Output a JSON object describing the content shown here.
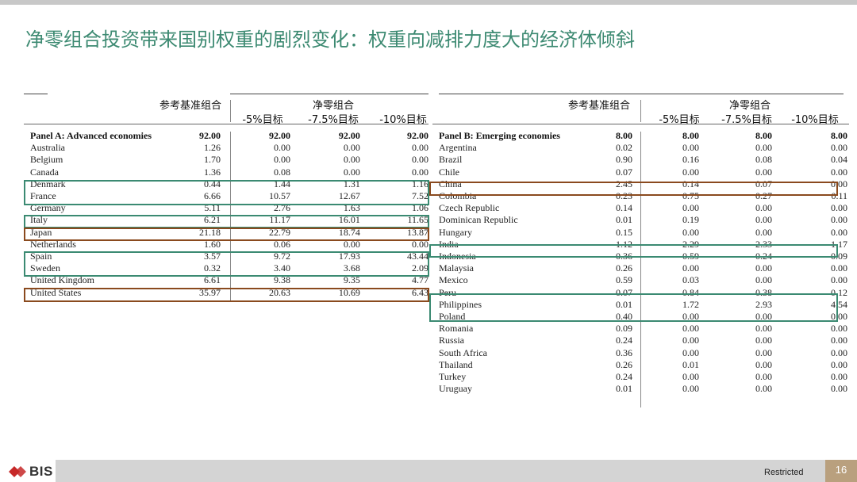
{
  "title": "净零组合投资带来国别权重的剧烈变化：权重向减排力度大的经济体倾斜",
  "headers": {
    "benchmark": "参考基准组合",
    "netzero": "净零组合",
    "t5": "-5%目标",
    "t75": "-7.5%目标",
    "t10": "-10%目标"
  },
  "panel_a": {
    "rows": [
      {
        "name": "Panel A: Advanced economies",
        "ref": "92.00",
        "v5": "92.00",
        "v75": "92.00",
        "v10": "92.00",
        "header": true
      },
      {
        "name": "Australia",
        "ref": "1.26",
        "v5": "0.00",
        "v75": "0.00",
        "v10": "0.00"
      },
      {
        "name": "Belgium",
        "ref": "1.70",
        "v5": "0.00",
        "v75": "0.00",
        "v10": "0.00"
      },
      {
        "name": "Canada",
        "ref": "1.36",
        "v5": "0.08",
        "v75": "0.00",
        "v10": "0.00"
      },
      {
        "name": "Denmark",
        "ref": "0.44",
        "v5": "1.44",
        "v75": "1.31",
        "v10": "1.16"
      },
      {
        "name": "France",
        "ref": "6.66",
        "v5": "10.57",
        "v75": "12.67",
        "v10": "7.52"
      },
      {
        "name": "Germany",
        "ref": "5.11",
        "v5": "2.76",
        "v75": "1.63",
        "v10": "1.06"
      },
      {
        "name": "Italy",
        "ref": "6.21",
        "v5": "11.17",
        "v75": "16.01",
        "v10": "11.65"
      },
      {
        "name": "Japan",
        "ref": "21.18",
        "v5": "22.79",
        "v75": "18.74",
        "v10": "13.87"
      },
      {
        "name": "Netherlands",
        "ref": "1.60",
        "v5": "0.06",
        "v75": "0.00",
        "v10": "0.00"
      },
      {
        "name": "Spain",
        "ref": "3.57",
        "v5": "9.72",
        "v75": "17.93",
        "v10": "43.44"
      },
      {
        "name": "Sweden",
        "ref": "0.32",
        "v5": "3.40",
        "v75": "3.68",
        "v10": "2.09"
      },
      {
        "name": "United Kingdom",
        "ref": "6.61",
        "v5": "9.38",
        "v75": "9.35",
        "v10": "4.77"
      },
      {
        "name": "United States",
        "ref": "35.97",
        "v5": "20.63",
        "v75": "10.69",
        "v10": "6.43"
      }
    ]
  },
  "panel_b": {
    "rows": [
      {
        "name": "Panel B: Emerging economies",
        "ref": "8.00",
        "v5": "8.00",
        "v75": "8.00",
        "v10": "8.00",
        "header": true
      },
      {
        "name": "Argentina",
        "ref": "0.02",
        "v5": "0.00",
        "v75": "0.00",
        "v10": "0.00"
      },
      {
        "name": "Brazil",
        "ref": "0.90",
        "v5": "0.16",
        "v75": "0.08",
        "v10": "0.04"
      },
      {
        "name": "Chile",
        "ref": "0.07",
        "v5": "0.00",
        "v75": "0.00",
        "v10": "0.00"
      },
      {
        "name": "China",
        "ref": "2.45",
        "v5": "0.14",
        "v75": "0.07",
        "v10": "0.00"
      },
      {
        "name": "Colombia",
        "ref": "0.23",
        "v5": "0.75",
        "v75": "0.27",
        "v10": "0.11"
      },
      {
        "name": "Czech Republic",
        "ref": "0.14",
        "v5": "0.00",
        "v75": "0.00",
        "v10": "0.00"
      },
      {
        "name": "Dominican Republic",
        "ref": "0.01",
        "v5": "0.19",
        "v75": "0.00",
        "v10": "0.00"
      },
      {
        "name": "Hungary",
        "ref": "0.15",
        "v5": "0.00",
        "v75": "0.00",
        "v10": "0.00"
      },
      {
        "name": "India",
        "ref": "1.12",
        "v5": "2.29",
        "v75": "2.33",
        "v10": "1.17"
      },
      {
        "name": "Indonesia",
        "ref": "0.36",
        "v5": "0.59",
        "v75": "0.24",
        "v10": "0.09"
      },
      {
        "name": "Malaysia",
        "ref": "0.26",
        "v5": "0.00",
        "v75": "0.00",
        "v10": "0.00"
      },
      {
        "name": "Mexico",
        "ref": "0.59",
        "v5": "0.03",
        "v75": "0.00",
        "v10": "0.00"
      },
      {
        "name": "Peru",
        "ref": "0.07",
        "v5": "0.84",
        "v75": "0.38",
        "v10": "0.12"
      },
      {
        "name": "Philippines",
        "ref": "0.01",
        "v5": "1.72",
        "v75": "2.93",
        "v10": "4.54"
      },
      {
        "name": "Poland",
        "ref": "0.40",
        "v5": "0.00",
        "v75": "0.00",
        "v10": "0.00"
      },
      {
        "name": "Romania",
        "ref": "0.09",
        "v5": "0.00",
        "v75": "0.00",
        "v10": "0.00"
      },
      {
        "name": "Russia",
        "ref": "0.24",
        "v5": "0.00",
        "v75": "0.00",
        "v10": "0.00"
      },
      {
        "name": "South Africa",
        "ref": "0.36",
        "v5": "0.00",
        "v75": "0.00",
        "v10": "0.00"
      },
      {
        "name": "Thailand",
        "ref": "0.26",
        "v5": "0.01",
        "v75": "0.00",
        "v10": "0.00"
      },
      {
        "name": "Turkey",
        "ref": "0.24",
        "v5": "0.00",
        "v75": "0.00",
        "v10": "0.00"
      },
      {
        "name": "Uruguay",
        "ref": "0.01",
        "v5": "0.00",
        "v75": "0.00",
        "v10": "0.00"
      }
    ]
  },
  "colors": {
    "title": "#3d8a72",
    "highlight_green": "#3b8a72",
    "highlight_brown": "#8a4a1e",
    "page_badge": "#b9a07e"
  },
  "footer": {
    "logo": "BIS",
    "restricted": "Restricted",
    "page": "16"
  }
}
